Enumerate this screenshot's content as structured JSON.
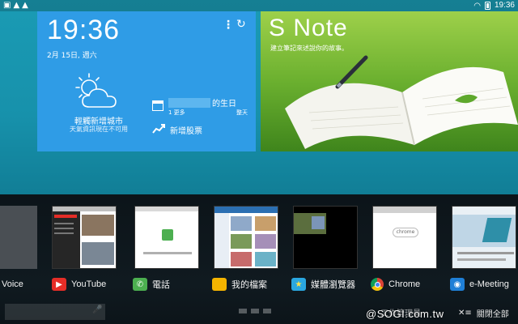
{
  "status_bar": {
    "time": "19:36",
    "left_icons": [
      "image-icon",
      "warning-icon",
      "warning-icon"
    ],
    "right_icons": [
      "wifi-icon",
      "battery-icon"
    ]
  },
  "clock_widget": {
    "time": "19:36",
    "date": "2月 15日, 週六",
    "city_prompt": "輕觸新增城市",
    "weather_status": "天氣資訊現在不可用",
    "birthday_title": "的生日",
    "birthday_more": "1 更多",
    "birthday_when": "整天",
    "add_stock": "新增股票"
  },
  "snote_widget": {
    "title": "S Note",
    "subtitle": "建立筆記來述說你的故事。"
  },
  "recent_apps": [
    {
      "name": "Voice"
    },
    {
      "name": "YouTube",
      "icon": "youtube-icon",
      "color": "#e52d27"
    },
    {
      "name": "電話",
      "icon": "phone-icon",
      "color": "#4caf50"
    },
    {
      "name": "我的檔案",
      "icon": "folder-icon",
      "color": "#f5b400"
    },
    {
      "name": "媒體瀏覽器",
      "icon": "media-browser-icon",
      "color": "#2aa7e0"
    },
    {
      "name": "Chrome",
      "icon": "chrome-icon",
      "color": "#4285f4"
    },
    {
      "name": "e-Meeting",
      "icon": "e-meeting-icon",
      "color": "#1f7fd6"
    }
  ],
  "bottom_bar": {
    "task_manager": "工作管理員",
    "close_all": "關閉全部",
    "watermark": "@SOGI.com.tw"
  }
}
